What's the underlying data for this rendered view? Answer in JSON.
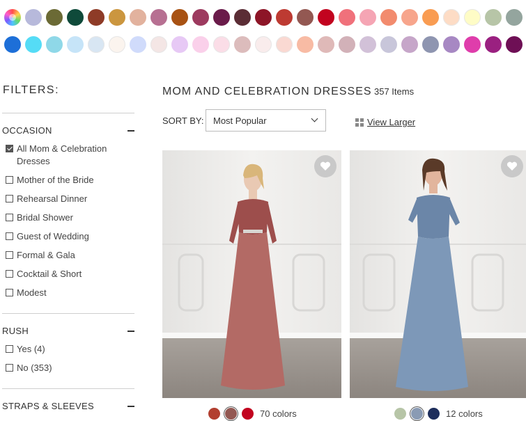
{
  "swatches": {
    "row1": [
      "multicolor",
      "#b7b9db",
      "#6b6a35",
      "#0f4a3a",
      "#8e3b27",
      "#cb963f",
      "#e2b29e",
      "#b77092",
      "#a85213",
      "#9d3a5f",
      "#6a1b4a",
      "#5b2d35",
      "#8d1527",
      "#bd3a32",
      "#935852",
      "#c2031f",
      "#f0717b",
      "#f5a5b4",
      "#f28b6e",
      "#f7a58c",
      "#f99c52",
      "#fddcc5",
      "#fefcc6",
      "#b7c5a7",
      "#94a59e"
    ],
    "row2": [
      "#1d6fd8",
      "#55dcf6",
      "#8fd8e8",
      "#c6e4f8",
      "#d8e6f3",
      "#fbf4ee",
      "#d0dbfb",
      "#f4e6e5",
      "#e7c9f5",
      "#fad0ea",
      "#fbdde7",
      "#dcbcbc",
      "#f9ecec",
      "#fad9d2",
      "#f8bba4",
      "#dfb9b8",
      "#d2b1b8",
      "#d2c1d8",
      "#c8c6da",
      "#c6a6c9",
      "#8e95b0",
      "#a788c3",
      "#df3dab",
      "#9a2080",
      "#6e0f55"
    ]
  },
  "filters": {
    "title": "FILTERS:",
    "occasion": {
      "label": "OCCASION",
      "options": [
        {
          "label": "All Mom & Celebration Dresses",
          "checked": true
        },
        {
          "label": "Mother of the Bride",
          "checked": false
        },
        {
          "label": "Rehearsal Dinner",
          "checked": false
        },
        {
          "label": "Bridal Shower",
          "checked": false
        },
        {
          "label": "Guest of Wedding",
          "checked": false
        },
        {
          "label": "Formal & Gala",
          "checked": false
        },
        {
          "label": "Cocktail & Short",
          "checked": false
        },
        {
          "label": "Modest",
          "checked": false
        }
      ]
    },
    "rush": {
      "label": "RUSH",
      "options": [
        {
          "label": "Yes (4)",
          "checked": false
        },
        {
          "label": "No (353)",
          "checked": false
        }
      ]
    },
    "straps": {
      "label": "STRAPS & SLEEVES"
    }
  },
  "main": {
    "title": "MOM AND CELEBRATION DRESSES",
    "count": "357 Items",
    "sort_label": "SORT BY:",
    "sort_value": "Most Popular",
    "view_larger": "View Larger"
  },
  "products": [
    {
      "colors": [
        "#b23f30",
        "#935852",
        "#c2031f"
      ],
      "selected_color": 1,
      "colors_label": "70 colors",
      "dress_color": "#b36a65",
      "lace_color": "#9d4e4c"
    },
    {
      "colors": [
        "#b7c5a7",
        "#8a9bb4",
        "#1e2e5c"
      ],
      "selected_color": 1,
      "colors_label": "12 colors",
      "dress_color": "#7d98b8",
      "lace_color": "#6b86a8"
    }
  ]
}
